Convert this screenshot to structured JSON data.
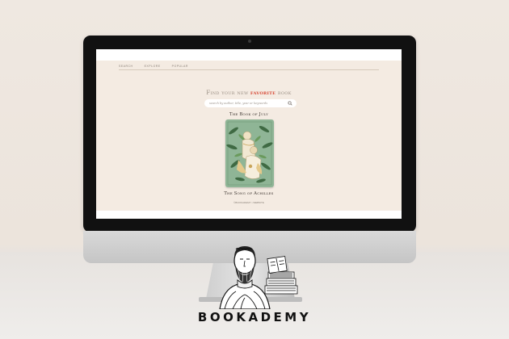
{
  "nav": {
    "items": [
      {
        "label": "Search"
      },
      {
        "label": "Explore"
      },
      {
        "label": "Popular"
      }
    ]
  },
  "hero": {
    "headline_before": "Find your new",
    "headline_accent": "favorite",
    "headline_after": "book"
  },
  "search": {
    "placeholder": "search by author, title, year or keywords"
  },
  "books": [
    {
      "title": "The Book of July"
    },
    {
      "title": "The Song of Achilles"
    }
  ],
  "footer": {
    "text": "©BOOKADEMY • WEBSITE"
  },
  "brand": {
    "name": "BOOKADEMY"
  },
  "colors": {
    "accent": "#d64532",
    "screen_bg": "#f4ebe2",
    "cover_bg": "#8fb596"
  },
  "icons": [
    "search-icon",
    "camera-icon"
  ]
}
